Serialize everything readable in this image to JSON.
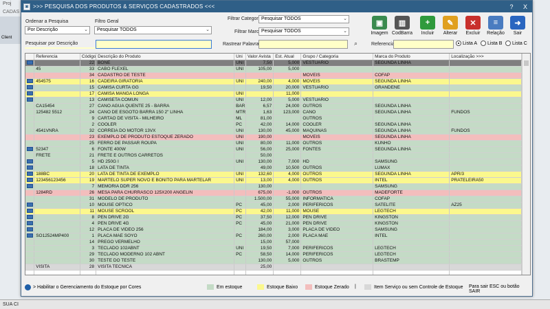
{
  "background_app": {
    "title": "Proj",
    "menu": "CADAS",
    "left_label": "Client",
    "status": "SUA CI"
  },
  "window": {
    "title": ">>> PESQUISA DOS PRODUTOS & SERVIÇOS CADASTRADOS <<<",
    "help": "?",
    "close": "X"
  },
  "filters": {
    "ordenar_label": "Ordenar a Pesquisa",
    "ordenar_value": "Por Descrição",
    "filtro_geral_label": "Filtro Geral",
    "filtro_geral_value": "Pesquisar TODOS",
    "filtrar_categoria_label": "Filtrar Categoria",
    "filtrar_categoria_value": "Pesquisar TODOS",
    "filtrar_marca_label": "Filtrar Marca",
    "filtrar_marca_value": "Pesquisar TODOS",
    "pesquisar_desc_label": "Pesquisar por Descrição",
    "pesquisar_desc_value": "",
    "rastrear_label": "Rastrear Palavras",
    "rastrear_value": "",
    "referencia_label": "Referencia",
    "referencia_value": ""
  },
  "toolbar": [
    {
      "label": "Imagem",
      "icon": "image-icon",
      "color": "#3a8a4e",
      "glyph": "▣"
    },
    {
      "label": "CodBarra",
      "icon": "barcode-icon",
      "color": "#555555",
      "glyph": "▥"
    },
    {
      "label": "Incluir",
      "icon": "add-icon",
      "color": "#2f9a3c",
      "glyph": "+"
    },
    {
      "label": "Alterar",
      "icon": "edit-icon",
      "color": "#e0a020",
      "glyph": "✎"
    },
    {
      "label": "Excluir",
      "icon": "delete-icon",
      "color": "#c8302c",
      "glyph": "✕"
    },
    {
      "label": "Relação",
      "icon": "report-icon",
      "color": "#4a7cc0",
      "glyph": "≡"
    },
    {
      "label": "Sair",
      "icon": "exit-icon",
      "color": "#2a66c0",
      "glyph": "➜"
    }
  ],
  "radios": [
    {
      "label": "Lista A",
      "selected": true
    },
    {
      "label": "Lista B",
      "selected": false
    },
    {
      "label": "Lista C",
      "selected": false
    }
  ],
  "table": {
    "columns": [
      "Referencia",
      "Código",
      "Descrição do Produto",
      "Uni",
      "Valor Avista",
      "Est. Atual",
      "Grupo / Categoria",
      "Marca do Produto",
      "Localização >>>"
    ],
    "rows": [
      {
        "s": "sel",
        "i": true,
        "ref": "",
        "cod": "22",
        "desc": "BONE",
        "uni": "UNI",
        "val": "7,50",
        "est": "5,000",
        "grp": "VESTUARIO",
        "marca": "SEGUNDA LINHA",
        "loc": ""
      },
      {
        "s": "green",
        "i": false,
        "ref": "45",
        "cod": "33",
        "desc": "CABO FLEXEL",
        "uni": "UNI",
        "val": "105,00",
        "est": "5,000",
        "grp": "",
        "marca": "",
        "loc": ""
      },
      {
        "s": "red",
        "i": false,
        "ref": "",
        "cod": "34",
        "desc": "CADASTRO DE TESTE",
        "uni": "",
        "val": "",
        "est": "",
        "grp": "MOVEIS",
        "marca": "COFAP",
        "loc": ""
      },
      {
        "s": "yellow",
        "i": true,
        "ref": "454575",
        "cod": "16",
        "desc": "CADEIRA GIRATORIA",
        "uni": "UNI",
        "val": "240,00",
        "est": "4,000",
        "grp": "MOVEIS",
        "marca": "SEGUNDA LINHA",
        "loc": ""
      },
      {
        "s": "green",
        "i": true,
        "ref": "",
        "cod": "15",
        "desc": "CAMISA CURTA GG",
        "uni": "",
        "val": "19,50",
        "est": "20,000",
        "grp": "VESTUARIO",
        "marca": "GRANDENE",
        "loc": ""
      },
      {
        "s": "yellow",
        "i": true,
        "ref": "",
        "cod": "17",
        "desc": "CAMISA MANGA LONGA",
        "uni": "UNI",
        "val": "",
        "est": "11,000",
        "grp": "",
        "marca": "",
        "loc": ""
      },
      {
        "s": "green",
        "i": true,
        "ref": "",
        "cod": "13",
        "desc": "CAMISETA COMUN",
        "uni": "UNI",
        "val": "12,00",
        "est": "5,000",
        "grp": "VESTUARIO",
        "marca": "",
        "loc": ""
      },
      {
        "s": "green",
        "i": false,
        "ref": "CA15454",
        "cod": "27",
        "desc": "CANO AGUA QUENTE 25 - BARRA",
        "uni": "BAR",
        "val": "6,57",
        "est": "24,000",
        "grp": "OUTROS",
        "marca": "SEGUNDA LINHA",
        "loc": ""
      },
      {
        "s": "green",
        "i": false,
        "ref": "125482 5512",
        "cod": "24",
        "desc": "CANO DE ESGOTO BARRA 150 2\" LINHA",
        "uni": "MTR",
        "val": "1,63",
        "est": "123,000",
        "grp": "CANO",
        "marca": "SEGUNDA LINHA",
        "loc": "FUNDOS"
      },
      {
        "s": "green",
        "i": false,
        "ref": "",
        "cod": "9",
        "desc": "CARTAO DE VISITA - MILHEIRO",
        "uni": "ML",
        "val": "81,00",
        "est": "",
        "grp": "OUTROS",
        "marca": "",
        "loc": ""
      },
      {
        "s": "green",
        "i": false,
        "ref": "",
        "cod": "2",
        "desc": "COOLER",
        "uni": "PC",
        "val": "42,00",
        "est": "14,000",
        "grp": "COOLER",
        "marca": "SEGUNDA LINHA",
        "loc": ""
      },
      {
        "s": "green",
        "i": false,
        "ref": "4541VNRA",
        "cod": "32",
        "desc": "CORREIA DO MOTOR 13VX",
        "uni": "UNI",
        "val": "130,00",
        "est": "45,000",
        "grp": "MAQUINAS",
        "marca": "SEGUNDA LINHA",
        "loc": "FUNDOS"
      },
      {
        "s": "red",
        "i": false,
        "ref": "",
        "cod": "23",
        "desc": "EXEMPLO DE PRODUTO ESTOQUE ZERADO",
        "uni": "UNI",
        "val": "190,00",
        "est": "",
        "grp": "MOVEIS",
        "marca": "SEGUNDA LINHA",
        "loc": ""
      },
      {
        "s": "green",
        "i": false,
        "ref": "",
        "cod": "25",
        "desc": "FERRO DE PASSAR ROUPA",
        "uni": "UNI",
        "val": "80,00",
        "est": "11,000",
        "grp": "OUTROS",
        "marca": "KUNHO",
        "loc": ""
      },
      {
        "s": "green",
        "i": true,
        "ref": "52347",
        "cod": "6",
        "desc": "FONTE 400W",
        "uni": "UNI",
        "val": "56,00",
        "est": "25,000",
        "grp": "FONTES",
        "marca": "SEGUNDA LINHA",
        "loc": ""
      },
      {
        "s": "green",
        "i": false,
        "ref": "FRETE",
        "cod": "21",
        "desc": "FRETE E OUTROS CARRETOS",
        "uni": "",
        "val": "50,00",
        "est": "",
        "grp": "",
        "marca": "",
        "loc": ""
      },
      {
        "s": "green",
        "i": true,
        "ref": "",
        "cod": "5",
        "desc": "HD 250G I",
        "uni": "UNI",
        "val": "130,00",
        "est": "7,000",
        "grp": "HD",
        "marca": "SAMSUNG",
        "loc": ""
      },
      {
        "s": "green",
        "i": true,
        "ref": "",
        "cod": "18",
        "desc": "LATA DE TINTA",
        "uni": "",
        "val": "49,00",
        "est": "10,500",
        "grp": "OUTROS",
        "marca": "LUMAX",
        "loc": ""
      },
      {
        "s": "yellow",
        "i": true,
        "ref": "188BC",
        "cod": "20",
        "desc": "LATA DE TINTA DE EXEMPLO",
        "uni": "UNI",
        "val": "132,60",
        "est": "4,000",
        "grp": "OUTROS",
        "marca": "SEGUNDA LINHA",
        "loc": "APR/3"
      },
      {
        "s": "yellow",
        "i": true,
        "ref": "123456123456",
        "cod": "19",
        "desc": "MARTELO SUPER NOVO E BONITO PARA MARTELAR",
        "uni": "UNI",
        "val": "13,00",
        "est": "4,000",
        "grp": "OUTROS",
        "marca": "INTEL",
        "loc": "PRATELEIRA50"
      },
      {
        "s": "green",
        "i": true,
        "ref": "",
        "cod": "7",
        "desc": "MEMORIA DDR 256",
        "uni": "",
        "val": "130,00",
        "est": "",
        "grp": "",
        "marca": "SAMSUNG",
        "loc": ""
      },
      {
        "s": "red",
        "i": false,
        "ref": "1284RD",
        "cod": "26",
        "desc": "MESA PARA CHURRASCO 125X200 ANGELIN",
        "uni": "",
        "val": "675,00",
        "est": "-1,000",
        "grp": "OUTROS",
        "marca": "MADEFORTE",
        "loc": ""
      },
      {
        "s": "green",
        "i": false,
        "ref": "",
        "cod": "31",
        "desc": "MODELO DE PRODUTO",
        "uni": "",
        "val": "1.500,00",
        "est": "55,000",
        "grp": "INFORMATICA",
        "marca": "COFAP",
        "loc": ""
      },
      {
        "s": "green",
        "i": true,
        "ref": "",
        "cod": "10",
        "desc": "MOUSE OPTICO",
        "uni": "PC",
        "val": "45,00",
        "est": "2,000",
        "grp": "PERIFERICOS",
        "marca": "SATELITE",
        "loc": "AZ25"
      },
      {
        "s": "yellow",
        "i": true,
        "ref": "",
        "cod": "11",
        "desc": "MOUSE SCROOL",
        "uni": "PC",
        "val": "42,00",
        "est": "11,000",
        "grp": "MOUSE",
        "marca": "LEGTECH",
        "loc": ""
      },
      {
        "s": "green",
        "i": true,
        "ref": "",
        "cod": "8",
        "desc": "PEN DRIVE 2G",
        "uni": "PC",
        "val": "37,50",
        "est": "12,000",
        "grp": "PEN DRIVE",
        "marca": "KINGSTON",
        "loc": ""
      },
      {
        "s": "green",
        "i": true,
        "ref": "",
        "cod": "4",
        "desc": "PEN DRIVE 4G",
        "uni": "PC",
        "val": "45,00",
        "est": "21,000",
        "grp": "PEN DRIVE",
        "marca": "KINGSTON",
        "loc": ""
      },
      {
        "s": "green",
        "i": true,
        "ref": "",
        "cod": "12",
        "desc": "PLACA DE VIDEO 256",
        "uni": "",
        "val": "184,00",
        "est": "3,000",
        "grp": "PLACA DE VIDEO",
        "marca": "SAMSUNG",
        "loc": ""
      },
      {
        "s": "green",
        "i": true,
        "ref": "SO12524MP400",
        "cod": "1",
        "desc": "PLACA MAE SOYO",
        "uni": "PC",
        "val": "260,00",
        "est": "2,000",
        "grp": "PLACA MÃE",
        "marca": "INTEL",
        "loc": ""
      },
      {
        "s": "green",
        "i": false,
        "ref": "",
        "cod": "14",
        "desc": "PREGO VERMELHO",
        "uni": "",
        "val": "15,00",
        "est": "57,000",
        "grp": "",
        "marca": "",
        "loc": ""
      },
      {
        "s": "green",
        "i": false,
        "ref": "",
        "cod": "3",
        "desc": "TECLADO 102ABNT",
        "uni": "UNI",
        "val": "19,50",
        "est": "7,000",
        "grp": "PERIFERICOS",
        "marca": "LEGTECH",
        "loc": ""
      },
      {
        "s": "green",
        "i": false,
        "ref": "",
        "cod": "29",
        "desc": "TECLADO MODERNO 102 ABNT",
        "uni": "PC",
        "val": "58,50",
        "est": "14,000",
        "grp": "PERIFERICOS",
        "marca": "LEGTECH",
        "loc": ""
      },
      {
        "s": "green",
        "i": false,
        "ref": "",
        "cod": "30",
        "desc": "TESTE DO TESTE",
        "uni": "",
        "val": "130,00",
        "est": "5,000",
        "grp": "OUTROS",
        "marca": "BRASTEMP",
        "loc": ""
      },
      {
        "s": "gray",
        "i": false,
        "ref": "VISITA",
        "cod": "28",
        "desc": "VISITA TECNICA",
        "uni": "",
        "val": "25,00",
        "est": "",
        "grp": "",
        "marca": "",
        "loc": ""
      }
    ]
  },
  "legend": {
    "habilitar": "> Habilitar o Gerenciamento do Estoque por Cores",
    "em_estoque": "Em estoque",
    "estoque_baixo": "Estoque Baixo",
    "estoque_zerado": "Estoque Zerado",
    "separator": "|",
    "servico": "Item Serviço ou sem Controle de Estoque",
    "sair_hint": "Para sair ESC ou botão SAIR",
    "colors": {
      "green": "#c4dbc6",
      "yellow": "#fbf88d",
      "red": "#f3bebd",
      "gray": "#d8d8d8"
    }
  }
}
